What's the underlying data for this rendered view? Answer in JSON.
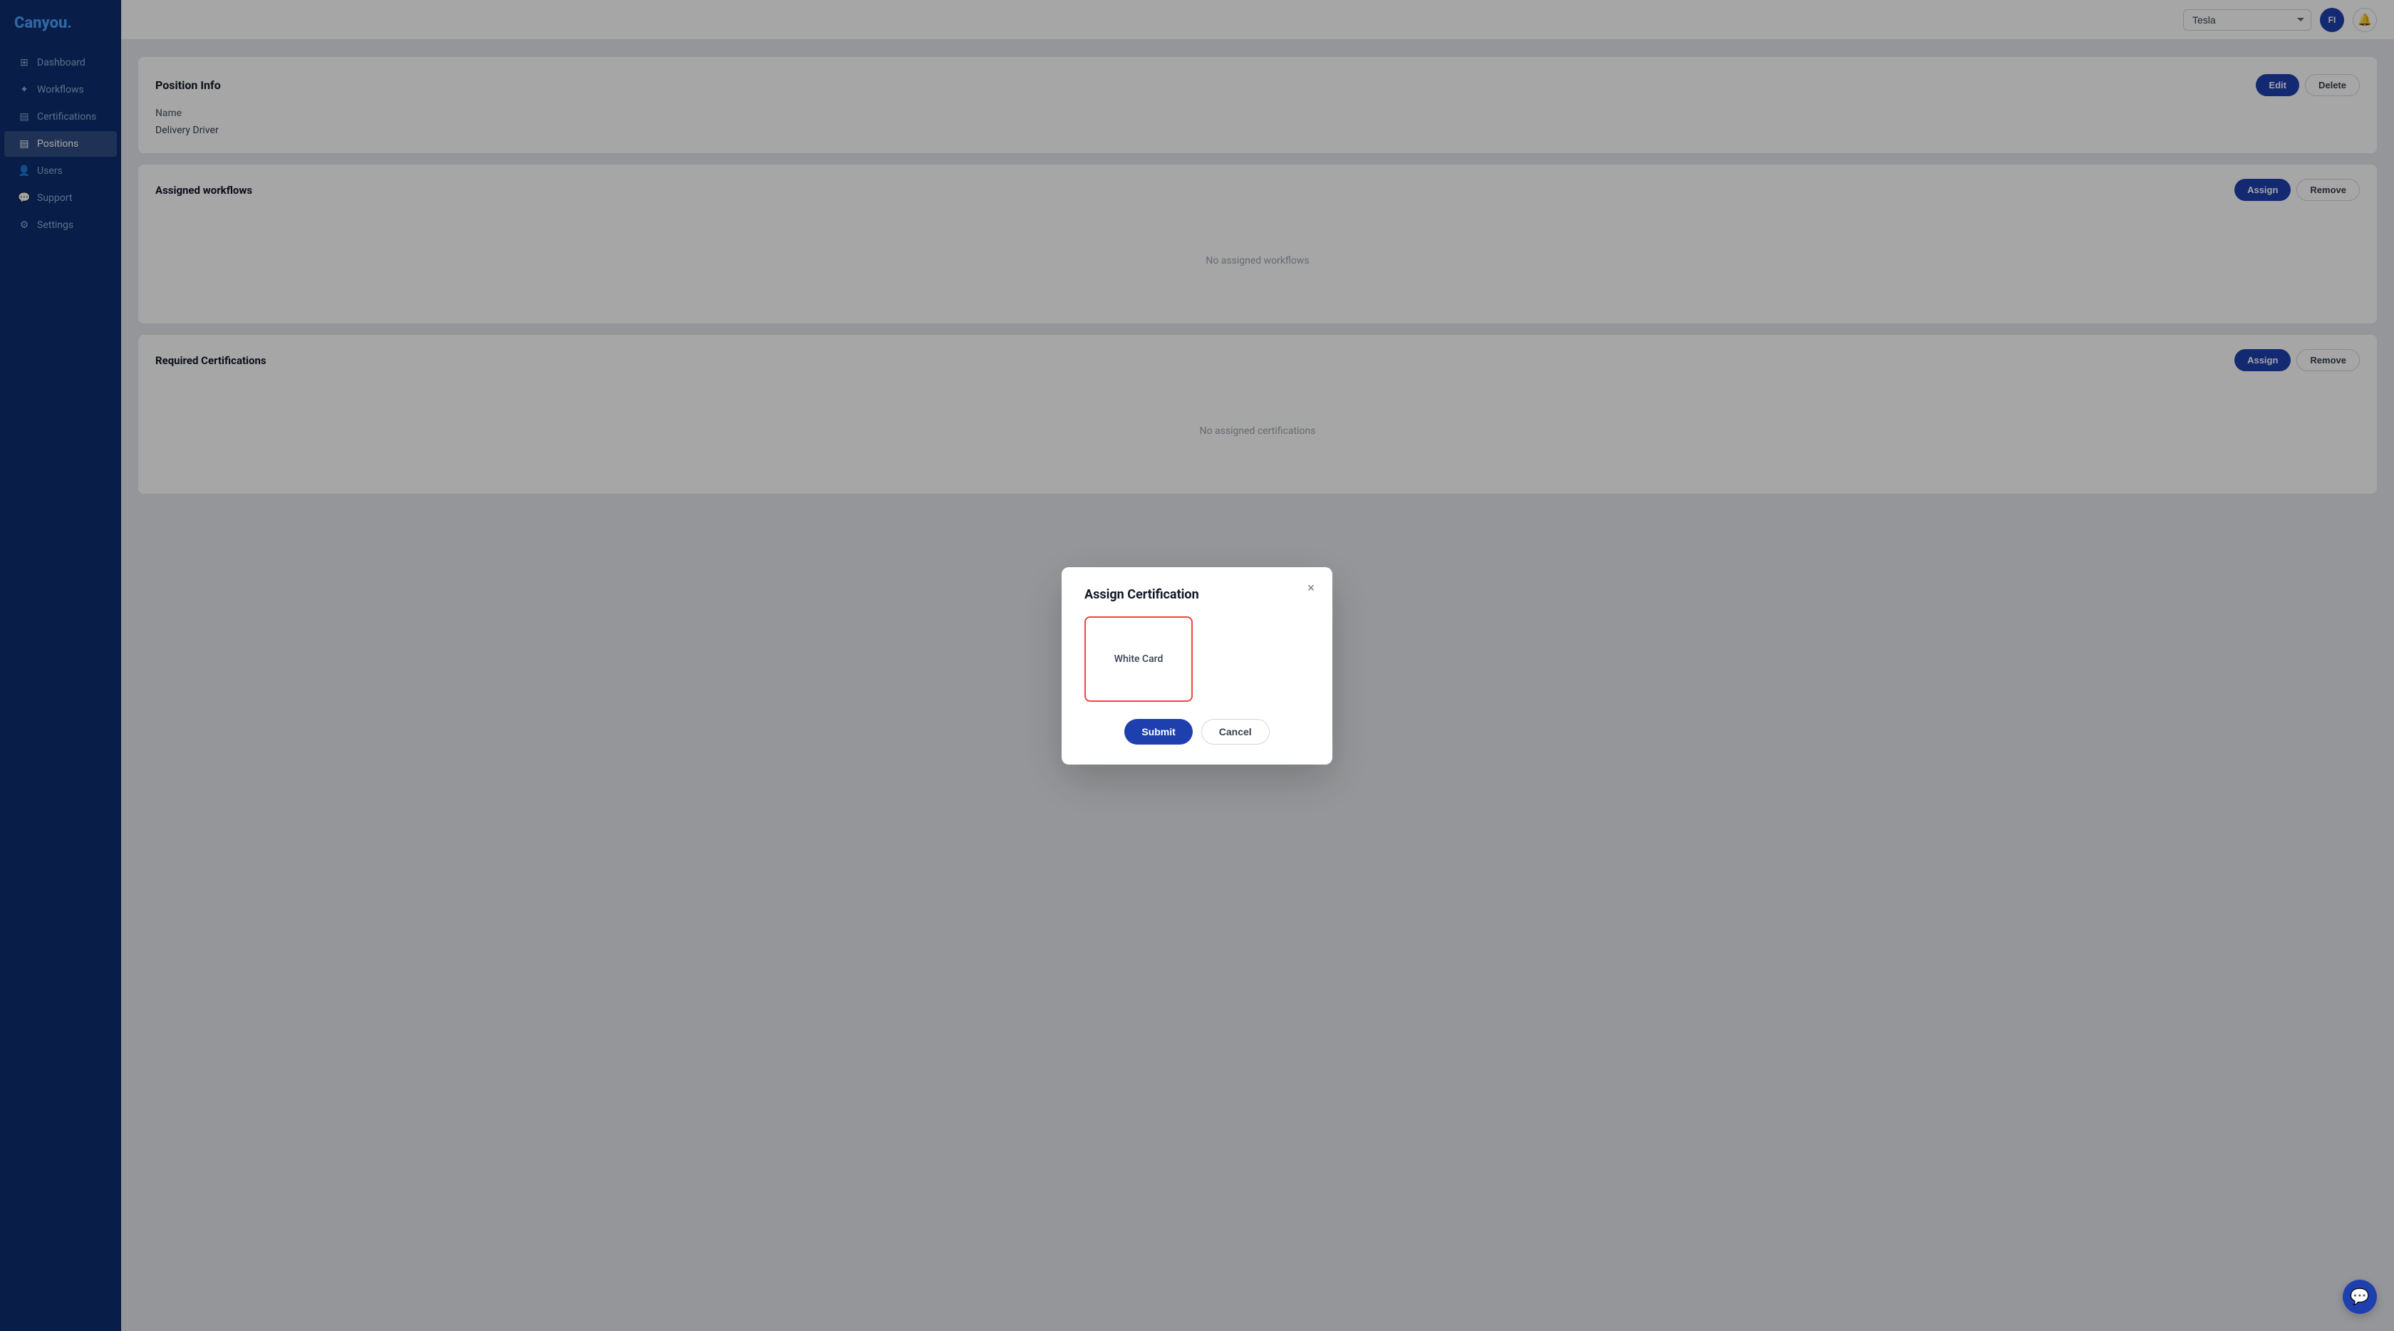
{
  "brand": {
    "logo": "Canyou.",
    "colors": {
      "primary": "#1e40af",
      "sidebar_bg": "#0d2d6e",
      "accent_red": "#ef4444"
    }
  },
  "header": {
    "company_select_value": "Tesla",
    "avatar_initials": "FI",
    "notification_icon": "🔔"
  },
  "sidebar": {
    "items": [
      {
        "label": "Dashboard",
        "icon": "⊞",
        "active": false
      },
      {
        "label": "Workflows",
        "icon": "✦",
        "active": false
      },
      {
        "label": "Certifications",
        "icon": "▤",
        "active": false
      },
      {
        "label": "Positions",
        "icon": "▤",
        "active": true
      },
      {
        "label": "Users",
        "icon": "👤",
        "active": false
      },
      {
        "label": "Support",
        "icon": "💬",
        "active": false
      },
      {
        "label": "Settings",
        "icon": "⚙",
        "active": false
      }
    ]
  },
  "page": {
    "position_info": {
      "title": "Position Info",
      "edit_label": "Edit",
      "delete_label": "Delete",
      "fields": [
        {
          "label": "Name",
          "value": ""
        },
        {
          "label": "Delivery Driver",
          "value": ""
        }
      ]
    },
    "assigned_workflows": {
      "title": "Assigned workflows",
      "assign_label": "Assign",
      "remove_label": "Remove",
      "empty_message": "No assigned workflows"
    },
    "required_certifications": {
      "title": "Required Certifications",
      "assign_label": "Assign",
      "remove_label": "Remove",
      "empty_message": "No assigned certifications"
    }
  },
  "modal": {
    "title": "Assign Certification",
    "close_label": "×",
    "certifications": [
      {
        "id": "white-card",
        "label": "White Card",
        "selected": true
      }
    ],
    "submit_label": "Submit",
    "cancel_label": "Cancel"
  },
  "chat_bubble": {
    "icon": "💬"
  }
}
